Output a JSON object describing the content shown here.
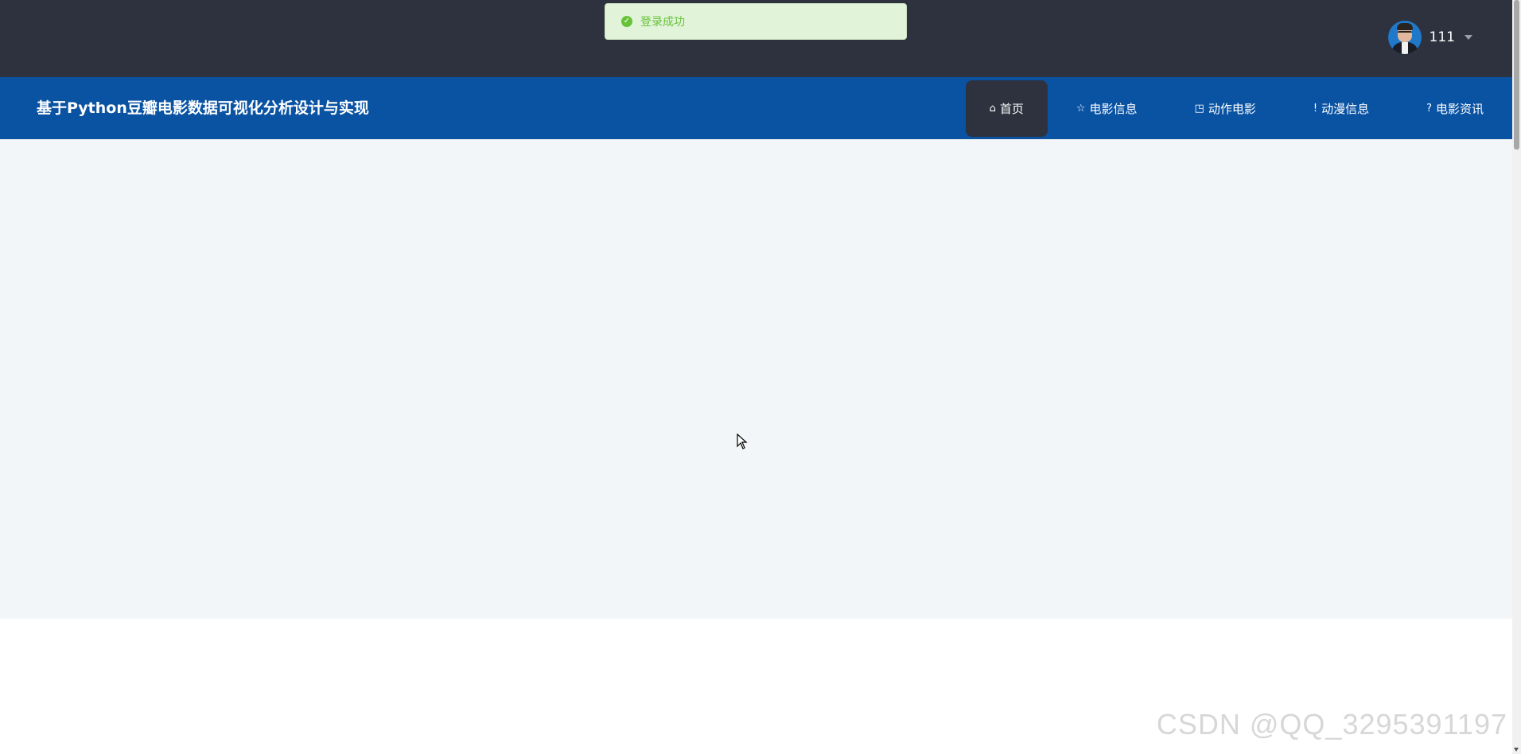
{
  "toast": {
    "message": "登录成功",
    "icon": "success-check-icon",
    "color": "#67c23a"
  },
  "user": {
    "name": "111",
    "avatar": "user-avatar"
  },
  "header": {
    "title": "基于Python豆瓣电影数据可视化分析设计与实现"
  },
  "nav": {
    "items": [
      {
        "label": "首页",
        "icon": "⌂",
        "active": true
      },
      {
        "label": "电影信息",
        "icon": "☆",
        "active": false
      },
      {
        "label": "动作电影",
        "icon": "◳",
        "active": false
      },
      {
        "label": "动漫信息",
        "icon": "!",
        "active": false
      },
      {
        "label": "电影资讯",
        "icon": "?",
        "active": false
      }
    ]
  },
  "watermark": "CSDN @QQ_3295391197",
  "colors": {
    "topbar": "#2d323e",
    "navbar": "#0a53a3",
    "content_bg": "#f3f6f8"
  }
}
